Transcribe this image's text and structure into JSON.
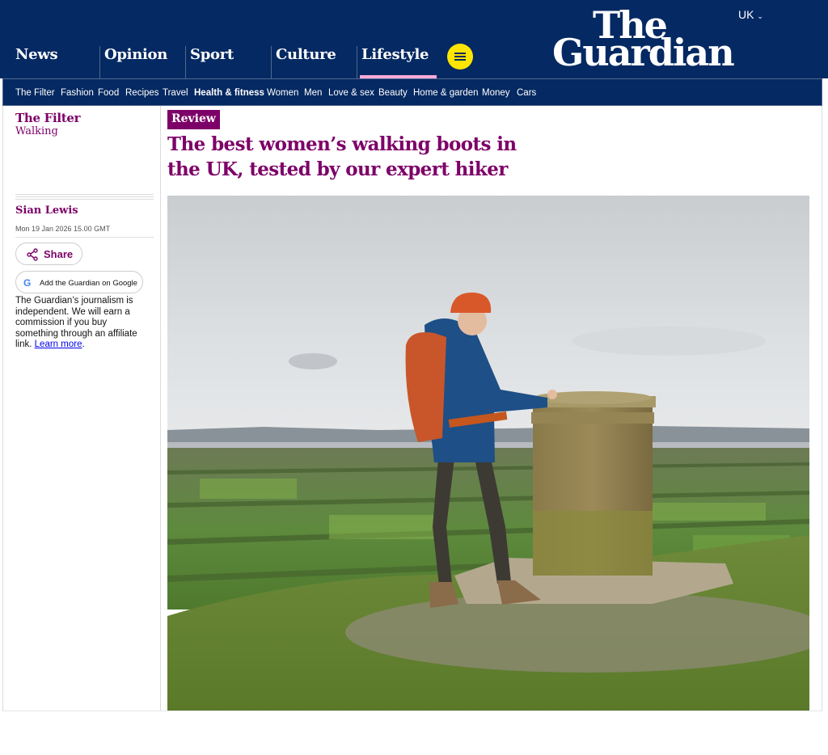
{
  "header": {
    "pillars": [
      {
        "label": "News"
      },
      {
        "label": "Opinion"
      },
      {
        "label": "Sport"
      },
      {
        "label": "Culture"
      },
      {
        "label": "Lifestyle",
        "active": true
      }
    ],
    "edition": "UK",
    "logo": {
      "line1": "The",
      "line2": "Guardian"
    },
    "colors": {
      "brand": "#052962",
      "lifestyle_accent": "#ffabdb",
      "menu_button": "#ffe500"
    }
  },
  "subnav": {
    "items": [
      "The Filter",
      "Fashion",
      "Food",
      "Recipes",
      "Travel",
      "Health & fitness",
      "Women",
      "Men",
      "Love & sex",
      "Beauty",
      "Home & garden",
      "Money",
      "Cars"
    ],
    "active": "Health & fitness"
  },
  "sidebar": {
    "series": "The Filter",
    "subseries": "Walking",
    "byline": "Sian Lewis",
    "date": "Mon 19 Jan 2026 15.00 GMT",
    "share_label": "Share",
    "google_label": "Add the Guardian on Google",
    "disclaimer": "The Guardian’s journalism is independent. We will earn a commission if you buy something through an affiliate link.",
    "learn_more": "Learn more",
    "accent_color": "#7d0068"
  },
  "article": {
    "kicker": "Review",
    "headline": "The best women’s walking boots in the UK, tested by our expert hiker"
  }
}
